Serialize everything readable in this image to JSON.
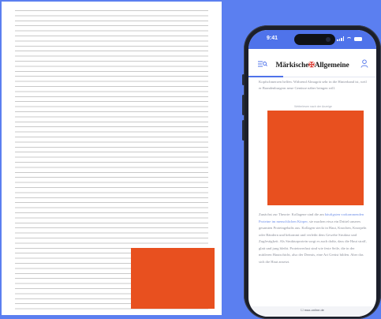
{
  "phone": {
    "status_time": "9:41",
    "brand_left": "Märkische",
    "brand_mark": "✠",
    "brand_right": "Allgemeine",
    "article_top": "Kopfschmerzen helfen. Während Almagrät sehr in die Hinterhand ist, weil er Brandenburgern neue Genüsse näher bringen will.",
    "ad_label": "Weiterlesen nach der Anzeige",
    "article_link": "häufigsten vorkommenden Proteine im menschlichen Körper,",
    "article_body_start": "Zunächst zur Theorie: Kollagene sind die am",
    "article_body_rest": "sie machen etwa ein Drittel unseres gesamten Proteingehalts aus. Kollagen steckt in Haut, Knochen, Knorpeln oder Bändern und bekommt und verleiht dem Gewebe Struktur und Zugfestigkeit. Als Strukturprotein sorgt es auch dafür, dass die Haut straff, glatt und jung bleibt. Proteinverlust sind wie feste Seile, die in der mittleren Hautschicht, also der Dermis, eine Art Gerüst bilden. Aber das sich die Haut ansetzt.",
    "url": "☐ maz-online.de"
  },
  "colors": {
    "background": "#5b7ff0",
    "accent_orange": "#e8501f",
    "brand_blue": "#4f73ea"
  }
}
